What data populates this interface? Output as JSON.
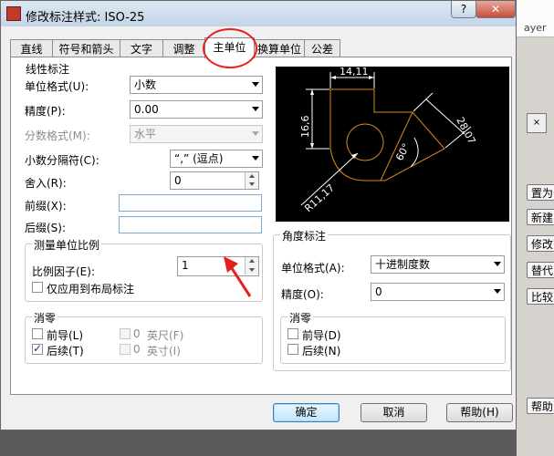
{
  "dialog": {
    "title": "修改标注样式: ISO-25",
    "help_glyph": "?",
    "close_glyph": "✕"
  },
  "tabs": [
    "直线",
    "符号和箭头",
    "文字",
    "调整",
    "主单位",
    "换算单位",
    "公差"
  ],
  "active_tab": "主单位",
  "linear": {
    "group_title": "线性标注",
    "unit_format_label": "单位格式(U):",
    "unit_format_value": "小数",
    "precision_label": "精度(P):",
    "precision_value": "0.00",
    "fraction_format_label": "分数格式(M):",
    "fraction_format_value": "水平",
    "decimal_separator_label": "小数分隔符(C):",
    "decimal_separator_value": "“,”  (逗点)",
    "round_off_label": "舍入(R):",
    "round_off_value": "0",
    "prefix_label": "前缀(X):",
    "suffix_label": "后缀(S):"
  },
  "scale": {
    "group_title": "测量单位比例",
    "factor_label": "比例因子(E):",
    "factor_value": "1",
    "layout_only_label": "仅应用到布局标注"
  },
  "zero_linear": {
    "group_title": "消零",
    "leading_label": "前导(L)",
    "trailing_label": "后续(T)",
    "feet_value": "0",
    "feet_label": "英尺(F)",
    "inch_value": "0",
    "inch_label": "英寸(I)",
    "leading_checked": false,
    "trailing_checked": true
  },
  "angular": {
    "group_title": "角度标注",
    "unit_format_label": "单位格式(A):",
    "unit_format_value": "十进制度数",
    "precision_label": "精度(O):",
    "precision_value": "0"
  },
  "zero_angular": {
    "group_title": "消零",
    "leading_label": "前导(D)",
    "trailing_label": "后续(N)"
  },
  "preview": {
    "dim_top": "14,11",
    "dim_left": "16,6",
    "dim_right": "28,07",
    "dim_angle": "60°",
    "dim_radius": "R11,17"
  },
  "buttons": {
    "ok": "确定",
    "cancel": "取消",
    "help": "帮助(H)"
  },
  "background": {
    "layer_text": "ayer",
    "side_buttons": [
      "置为当",
      "新建",
      "修改",
      "替代",
      "比较",
      "帮助"
    ],
    "close_mark": "×"
  },
  "colors": {
    "annotation_red": "#e8201c",
    "preview_geometry": "#d98a1c",
    "preview_dims": "#ffffff"
  }
}
